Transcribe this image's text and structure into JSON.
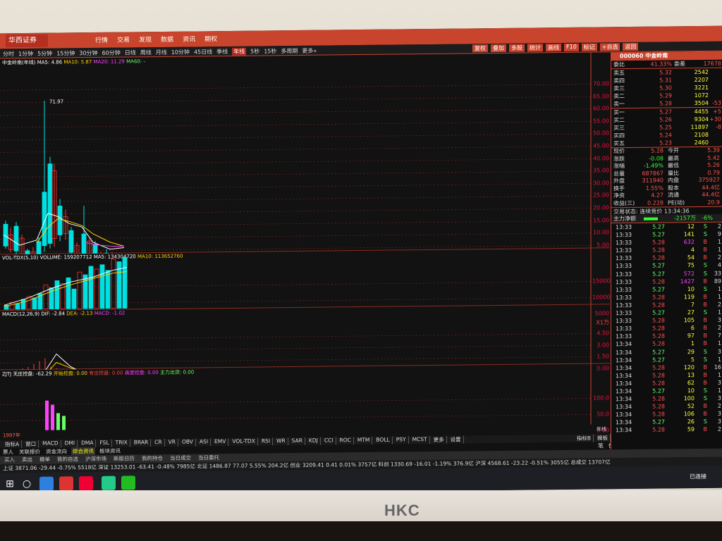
{
  "monitor": {
    "brand": "HKC"
  },
  "app": {
    "logo": "华西证券",
    "menu": [
      "行情",
      "交易",
      "发现",
      "数据",
      "资讯",
      "期权"
    ],
    "periods": [
      "分时",
      "1分钟",
      "5分钟",
      "15分钟",
      "30分钟",
      "60分钟",
      "日线",
      "周线",
      "月线",
      "10分钟",
      "45日线",
      "季线",
      "年线",
      "5秒",
      "15秒",
      "多周期",
      "更多»"
    ],
    "active_period": "年线",
    "tools": [
      "复权",
      "叠加",
      "多股",
      "统计",
      "画线",
      "F10",
      "标记",
      "+自选",
      "返回"
    ]
  },
  "main_chart": {
    "title": "中金岭南(年线)",
    "ma5": "MA5: 4.86",
    "ma10": "MA10: 5.87",
    "ma20": "MA20: 11.29",
    "ma60": "MA60: -",
    "high_label": "71.97",
    "low_label": "3.38",
    "y_ticks": [
      "70.00",
      "65.00",
      "60.00",
      "55.00",
      "50.00",
      "45.00",
      "40.00",
      "35.00",
      "30.00",
      "25.00",
      "20.00",
      "15.00",
      "10.00",
      "5.00"
    ]
  },
  "vol_panel": {
    "label": "VOL-TDX(5,10)",
    "volume": "VOLUME: 159207712",
    "ma5": "MA5: 134304720",
    "ma10": "MA10: 113652760",
    "y_ticks": [
      "15000",
      "10000",
      "5000"
    ],
    "unit": "X1万"
  },
  "macd_panel": {
    "label": "MACD(12,26,9)",
    "dif": "DIF: -2.84",
    "dea": "DEA: -2.13",
    "macd": "MACD: -1.02",
    "y_ticks": [
      "4.50",
      "3.00",
      "1.50",
      "0.00"
    ]
  },
  "zjtj_panel": {
    "label": "ZJTJ",
    "zhuang": "无庄控盘: -62.29",
    "kaishi": "开始控盘: 0.00",
    "youzhuang": "有庄控盘: 0.00",
    "gaodu": "高度控盘: 0.00",
    "chuhuo": "主力出货: 0.00",
    "y_ticks": [
      "100.0",
      "50.0",
      "0.00"
    ]
  },
  "year_label": "1997年",
  "period_label": "年线",
  "indicator_tabs": [
    "指标A",
    "窗口",
    "MACD",
    "DMI",
    "DMA",
    "FSL",
    "TRIX",
    "BRAR",
    "CR",
    "VR",
    "OBV",
    "ASI",
    "EMV",
    "VOL-TDX",
    "RSI",
    "WR",
    "SAR",
    "KDJ",
    "CCI",
    "ROC",
    "MTM",
    "BOLL",
    "PSY",
    "MCST",
    "更多",
    "设置"
  ],
  "indicator_right": [
    "指标B",
    "模板"
  ],
  "sub_tabs": [
    "票人",
    "关联报价",
    "资金流向",
    "综合资讯",
    "板块资讯"
  ],
  "right_tabs": [
    "笔",
    "价",
    "细",
    "势",
    "联",
    "值",
    "主",
    "筹"
  ],
  "quote": {
    "code": "000060",
    "name": "中金岭南",
    "webi_label": "委比",
    "webi": "41.33%",
    "weicha_label": "委差",
    "weicha": "17678",
    "sell": [
      {
        "label": "卖五",
        "price": "5.32",
        "vol": "2542",
        "chg": ""
      },
      {
        "label": "卖四",
        "price": "5.31",
        "vol": "2207",
        "chg": ""
      },
      {
        "label": "卖三",
        "price": "5.30",
        "vol": "3221",
        "chg": ""
      },
      {
        "label": "卖二",
        "price": "5.29",
        "vol": "1072",
        "chg": ""
      },
      {
        "label": "卖一",
        "price": "5.28",
        "vol": "3504",
        "chg": "-53"
      }
    ],
    "buy": [
      {
        "label": "买一",
        "price": "5.27",
        "vol": "4455",
        "chg": "+5"
      },
      {
        "label": "买二",
        "price": "5.26",
        "vol": "9304",
        "chg": "+30"
      },
      {
        "label": "买三",
        "price": "5.25",
        "vol": "11897",
        "chg": "-8"
      },
      {
        "label": "买四",
        "price": "5.24",
        "vol": "2108",
        "chg": ""
      },
      {
        "label": "买五",
        "price": "5.23",
        "vol": "2460",
        "chg": ""
      }
    ],
    "stats": [
      {
        "k": "现价",
        "v": "5.28",
        "k2": "今开",
        "v2": "5.39"
      },
      {
        "k": "涨跌",
        "v": "-0.08",
        "k2": "最高",
        "v2": "5.42"
      },
      {
        "k": "涨幅",
        "v": "-1.49%",
        "k2": "最低",
        "v2": "5.26"
      },
      {
        "k": "总量",
        "v": "687867",
        "k2": "量比",
        "v2": "0.79"
      },
      {
        "k": "外盘",
        "v": "311940",
        "k2": "内盘",
        "v2": "375927"
      },
      {
        "k": "换手",
        "v": "1.55%",
        "k2": "股本",
        "v2": "44.4亿"
      },
      {
        "k": "净资",
        "v": "4.27",
        "k2": "流通",
        "v2": "44.4亿"
      },
      {
        "k": "收益(三)",
        "v": "0.228",
        "k2": "PE(动)",
        "v2": "20.9"
      }
    ],
    "status": "交易状态: 连续竞价 13:34:36",
    "main_force_label": "主力净额",
    "main_force": "-2157万",
    "main_force_pct": "-6%",
    "ticks": [
      {
        "t": "13:33",
        "p": "5.27",
        "v": "12",
        "s": "S",
        "x": "2"
      },
      {
        "t": "13:33",
        "p": "5.27",
        "v": "141",
        "s": "S",
        "x": "9"
      },
      {
        "t": "13:33",
        "p": "5.28",
        "v": "632",
        "s": "B",
        "x": "1"
      },
      {
        "t": "13:33",
        "p": "5.28",
        "v": "4",
        "s": "B",
        "x": "1"
      },
      {
        "t": "13:33",
        "p": "5.28",
        "v": "54",
        "s": "B",
        "x": "2"
      },
      {
        "t": "13:33",
        "p": "5.27",
        "v": "75",
        "s": "S",
        "x": "4"
      },
      {
        "t": "13:33",
        "p": "5.27",
        "v": "572",
        "s": "S",
        "x": "33"
      },
      {
        "t": "13:33",
        "p": "5.28",
        "v": "1427",
        "s": "B",
        "x": "89"
      },
      {
        "t": "13:33",
        "p": "5.27",
        "v": "10",
        "s": "S",
        "x": "1"
      },
      {
        "t": "13:33",
        "p": "5.28",
        "v": "119",
        "s": "B",
        "x": "1"
      },
      {
        "t": "13:33",
        "p": "5.28",
        "v": "7",
        "s": "B",
        "x": "2"
      },
      {
        "t": "13:33",
        "p": "5.27",
        "v": "27",
        "s": "S",
        "x": "1"
      },
      {
        "t": "13:33",
        "p": "5.28",
        "v": "105",
        "s": "B",
        "x": "3"
      },
      {
        "t": "13:33",
        "p": "5.28",
        "v": "6",
        "s": "B",
        "x": "2"
      },
      {
        "t": "13:33",
        "p": "5.28",
        "v": "97",
        "s": "B",
        "x": "7"
      },
      {
        "t": "13:34",
        "p": "5.28",
        "v": "1",
        "s": "B",
        "x": "1"
      },
      {
        "t": "13:34",
        "p": "5.27",
        "v": "29",
        "s": "S",
        "x": "3"
      },
      {
        "t": "13:34",
        "p": "5.27",
        "v": "5",
        "s": "S",
        "x": "1"
      },
      {
        "t": "13:34",
        "p": "5.28",
        "v": "120",
        "s": "B",
        "x": "16"
      },
      {
        "t": "13:34",
        "p": "5.28",
        "v": "13",
        "s": "B",
        "x": "1"
      },
      {
        "t": "13:34",
        "p": "5.28",
        "v": "62",
        "s": "B",
        "x": "3"
      },
      {
        "t": "13:34",
        "p": "5.27",
        "v": "10",
        "s": "S",
        "x": "1"
      },
      {
        "t": "13:34",
        "p": "5.28",
        "v": "100",
        "s": "S",
        "x": "3"
      },
      {
        "t": "13:34",
        "p": "5.28",
        "v": "52",
        "s": "B",
        "x": "2"
      },
      {
        "t": "13:34",
        "p": "5.28",
        "v": "106",
        "s": "B",
        "x": "3"
      },
      {
        "t": "13:34",
        "p": "5.27",
        "v": "26",
        "s": "S",
        "x": "3"
      },
      {
        "t": "13:34",
        "p": "5.28",
        "v": "59",
        "s": "B",
        "x": "2"
      }
    ]
  },
  "funcbar": [
    "买入",
    "卖出",
    "撤单",
    "我的自选",
    "沪深市场",
    "新股日历",
    "我的持仓",
    "当日成交",
    "当日委托"
  ],
  "indexbar": "上证 3871.06  -29.44  -0.75%  5518亿   深证 13253.01  -63.41  -0.48%  7985亿   北证 1486.87  77.07  5.55%  204.2亿   创业 3209.41  0.41  0.01%  3757亿   科创 1330.69  -16.01  -1.19%  376.9亿   沪深 4568.61  -23.22  -0.51%  3055亿   总成交 13707亿",
  "taskbar": {
    "status": "已连接"
  },
  "chart_data": [
    {
      "type": "candlestick",
      "title": "中金岭南(年线)",
      "ylim": [
        0,
        72
      ],
      "annotations": [
        "71.97",
        "3.38"
      ]
    },
    {
      "type": "bar",
      "title": "VOL-TDX(5,10)",
      "ylabel": "X1万",
      "ylim": [
        0,
        17000
      ]
    },
    {
      "type": "bar",
      "title": "MACD(12,26,9)",
      "ylim": [
        -3,
        5
      ]
    }
  ]
}
